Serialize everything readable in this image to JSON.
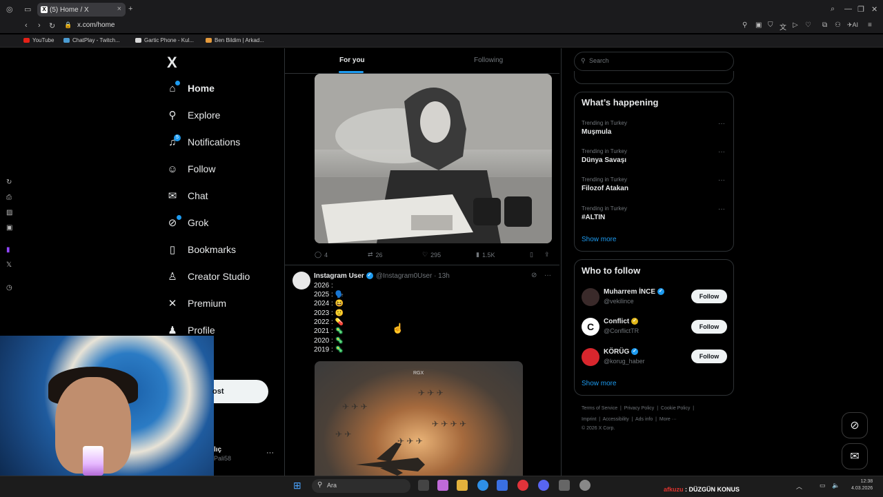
{
  "browser": {
    "tab_title": "(5) Home / X",
    "url": "x.com/home",
    "bookmarks": [
      "YouTube",
      "ChatPlay - Twitch...",
      "Gartic Phone - Kul...",
      "Ben Bildim | Arkad..."
    ]
  },
  "nav": {
    "logo": "X",
    "items": [
      {
        "label": "Home",
        "icon": "home-icon"
      },
      {
        "label": "Explore",
        "icon": "search-icon"
      },
      {
        "label": "Notifications",
        "icon": "bell-icon",
        "badge": "5"
      },
      {
        "label": "Follow",
        "icon": "person-add-icon"
      },
      {
        "label": "Chat",
        "icon": "envelope-icon"
      },
      {
        "label": "Grok",
        "icon": "grok-icon"
      },
      {
        "label": "Bookmarks",
        "icon": "bookmark-icon"
      },
      {
        "label": "Creator Studio",
        "icon": "creator-studio-icon"
      },
      {
        "label": "Premium",
        "icon": "x-premium-icon"
      },
      {
        "label": "Profile",
        "icon": "person-icon"
      }
    ],
    "post_label": "ost",
    "account_name": "lıç",
    "account_handle": "Pali58"
  },
  "feed": {
    "tabs": [
      "For you",
      "Following"
    ],
    "tweet1": {
      "replies": "4",
      "reposts": "26",
      "likes": "295",
      "views": "1.5K"
    },
    "tweet2": {
      "name": "Instagram User",
      "handle": "@Instagram0User · 13h",
      "lines": [
        "2026 :",
        "2025 : 🗣️",
        "2024 : 😆",
        "2023 : 🙂",
        "2022 : 💊",
        "2021 : 🦠",
        "2020 : 🦠",
        "2019 : 🦠"
      ],
      "media_watermark": "RGX"
    }
  },
  "sidebar": {
    "search_placeholder": "Search",
    "whats_happening_title": "What’s happening",
    "trends": [
      {
        "context": "Trending in Turkey",
        "name": "Muşmula"
      },
      {
        "context": "Trending in Turkey",
        "name": "Dünya Savaşı"
      },
      {
        "context": "Trending in Turkey",
        "name": "Filozof Atakan"
      },
      {
        "context": "Trending in Turkey",
        "name": "#ALTIN"
      }
    ],
    "show_more": "Show more",
    "who_to_follow_title": "Who to follow",
    "who_to_follow": [
      {
        "name": "Muharrem İNCE",
        "handle": "@vekilince",
        "badge_color": "#1d9bf0"
      },
      {
        "name": "Conflict",
        "handle": "@ConflictTR",
        "badge_color": "#e2b719"
      },
      {
        "name": "KÖRÜG",
        "handle": "@korug_haber",
        "badge_color": "#1d9bf0"
      }
    ],
    "follow_label": "Follow",
    "footer": [
      "Terms of Service",
      "Privacy Policy",
      "Cookie Policy",
      "Imprint",
      "Accessibility",
      "Ads info",
      "More ···",
      "© 2026 X Corp."
    ]
  },
  "taskbar": {
    "search_text": "Ara",
    "ticker_prefix": "afkuzu",
    "ticker_text": ": DÜZGÜN KONUS",
    "time": "12:38",
    "date": "4.03.2026"
  },
  "colors": {
    "accent": "#1d9bf0",
    "bg": "#000000",
    "border": "#2f3336",
    "muted": "#71767b"
  }
}
